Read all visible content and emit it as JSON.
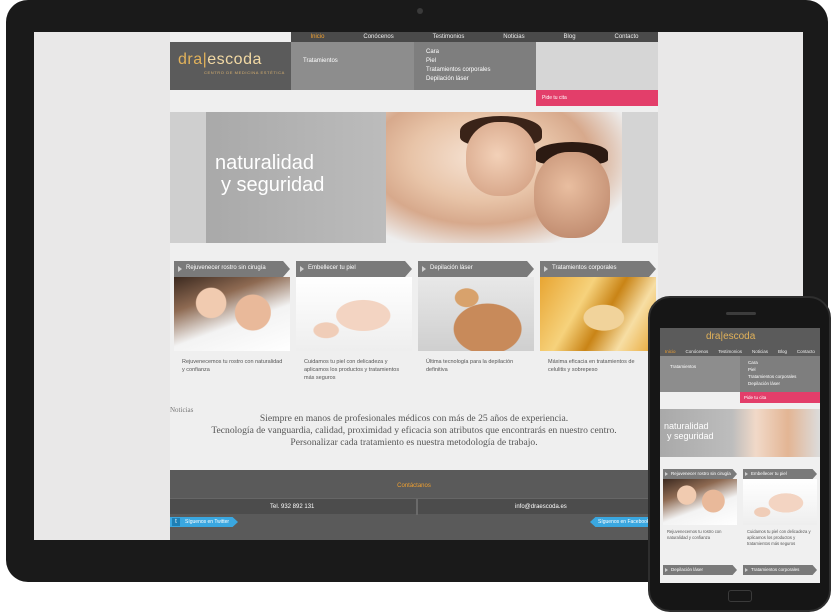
{
  "site": {
    "logo": {
      "part1": "dra",
      "part2": "escoda",
      "tagline": "CENTRO DE MEDICINA ESTÉTICA"
    },
    "nav": [
      "Inicio",
      "Conócenos",
      "Testimonios",
      "Noticias",
      "Blog",
      "Contacto"
    ],
    "active_nav": "Inicio",
    "menu": {
      "section": "Tratamientos",
      "items": [
        "Cara",
        "Piel",
        "Tratamientos corporales",
        "Depilación láser"
      ]
    },
    "cta_label": "Pide tu cita",
    "hero": {
      "line1": "naturalidad",
      "line2": "y seguridad"
    },
    "cards": [
      {
        "title": "Rejuvenecer rostro sin cirugía",
        "text": "Rejuvenecemos tu rostro con naturalidad y confianza"
      },
      {
        "title": "Embellecer tu piel",
        "text": "Cuidamos tu piel con delicadeza y aplicamos los productos y tratamientos más seguros"
      },
      {
        "title": "Depilación láser",
        "text": "Última tecnología para la depilación definitiva"
      },
      {
        "title": "Tratamientos corporales",
        "text": "Máxima eficacia en tratamientos de celulitis y sobrepeso"
      }
    ],
    "news_title": "Noticias",
    "slogan": [
      "Siempre en manos de profesionales médicos con más de 25 años de experiencia.",
      "Tecnología de vanguardia, calidad, proximidad y eficacia son atributos que encontrarás en nuestro centro.",
      "Personalizar cada tratamiento es nuestra metodología de trabajo."
    ],
    "footer": {
      "title": "Contáctanos",
      "phone": "Tel. 932 892 131",
      "email": "info@draescoda.es",
      "twitter_label": "Síguenos en Twitter",
      "facebook_label": "Síguenos en Facebook"
    }
  },
  "mobile": {
    "nav": [
      "Inicio",
      "Conócenos",
      "Testimonios",
      "Noticias",
      "Blog",
      "Contacto"
    ],
    "bottom_cards": [
      "Depilación láser",
      "Tratamientos corporales"
    ]
  },
  "colors": {
    "accent": "#e33e6a",
    "gold": "#e2b25a",
    "nav_bg": "#4a4a4a",
    "twitter": "#3aa7e0"
  }
}
